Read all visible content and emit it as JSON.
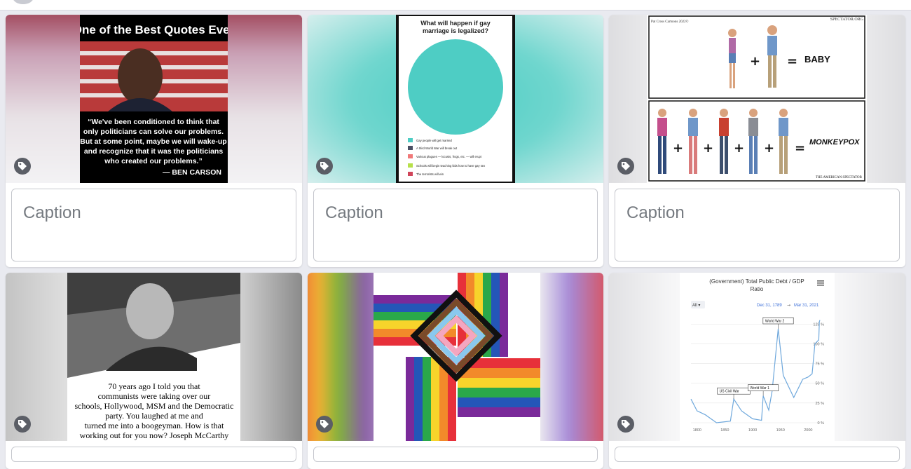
{
  "cards": [
    {
      "meme": {
        "title": "One of the Best Quotes Ever",
        "quote_lines": [
          "“We've been conditioned to think that",
          "only politicians can solve our problems.",
          "But at some point, maybe we will wake-up",
          "and recognize that it was the politicians",
          "who created our problems.”"
        ],
        "author": "— BEN CARSON"
      },
      "caption_placeholder": "Caption"
    },
    {
      "meme": {
        "title_lines": [
          "What will happen if gay",
          "marriage is legalized?"
        ],
        "legend": [
          {
            "label": "Gay people will get married",
            "color": "#4ecdc4"
          },
          {
            "label": "A third World War will break out",
            "color": "#4a4f63"
          },
          {
            "label": "Various plagues — locusts, frogs, etc. — will erupt",
            "color": "#f07878"
          },
          {
            "label": "Schools will begin teaching kids how to have gay sex",
            "color": "#b7e04a"
          },
          {
            "label": "The terrorists will win",
            "color": "#d0455a"
          }
        ]
      },
      "caption_placeholder": "Caption"
    },
    {
      "meme": {
        "credit": "Pat Cross Cartoons 2022©",
        "source": "SPECTATOR.ORG",
        "top_result": "BABY",
        "bottom_result": "MONKEYPOX",
        "publisher": "THE AMERICAN SPECTATOR"
      },
      "caption_placeholder": "Caption"
    },
    {
      "meme": {
        "quote_lines": [
          "70 years ago I told you that",
          "communists were taking over our",
          "schools, Hollywood, MSM and the Democratic",
          "party. You laughed at me and",
          "turned me into a boogeyman. How is that",
          "working out for you now?  Joseph McCarthy"
        ]
      }
    },
    {
      "meme": {}
    },
    {
      "meme": {
        "title_lines": [
          "(Government) Total Public Debt / GDP",
          "Ratio"
        ],
        "range_button": "All ▾",
        "date_from": "Dec 31, 1789",
        "date_arrow": "→",
        "date_to": "Mar 31, 2021",
        "chart_data": {
          "type": "line",
          "x": [
            1789,
            1800,
            1815,
            1835,
            1860,
            1866,
            1880,
            1900,
            1916,
            1919,
            1929,
            1935,
            1946,
            1955,
            1974,
            1990,
            2000,
            2007,
            2012,
            2019,
            2020,
            2021
          ],
          "y": [
            30,
            15,
            10,
            0,
            2,
            30,
            15,
            5,
            3,
            34,
            16,
            40,
            119,
            60,
            32,
            55,
            58,
            62,
            100,
            105,
            128,
            130
          ],
          "xticks": [
            "1800",
            "1850",
            "1900",
            "1950",
            "2000"
          ],
          "yticks": [
            "0 %",
            "25 %",
            "50 %",
            "75 %",
            "100 %",
            "125 %"
          ],
          "ylim": [
            0,
            135
          ],
          "xlim": [
            1789,
            2021
          ],
          "annotations": [
            "US Civil War",
            "World War 1",
            "World War 2"
          ],
          "color": "#6fa8dc"
        }
      }
    }
  ]
}
